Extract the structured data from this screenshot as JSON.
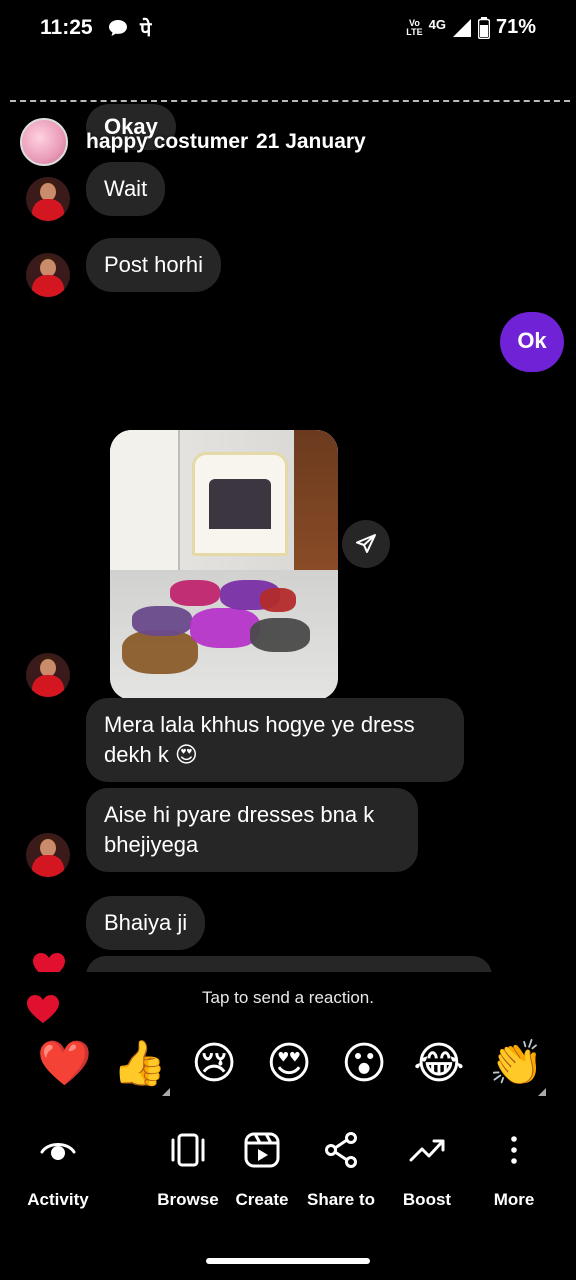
{
  "status_bar": {
    "time": "11:25",
    "hindi_char": "पे",
    "volte_top": "Vo",
    "volte_bottom": "LTE",
    "network": "4G",
    "battery": "71%"
  },
  "chat": {
    "header": {
      "partial_message": "Okay",
      "name": "happy costumer",
      "date": "21 January"
    },
    "messages": [
      {
        "text": "Wait",
        "sender": "other"
      },
      {
        "text": "Post horhi",
        "sender": "other"
      },
      {
        "text": "Ok",
        "sender": "me"
      },
      {
        "text": "Mera lala khhus hogye ye dress dekh k 😍",
        "sender": "other"
      },
      {
        "text": "Aise hi pyare dresses bna k bhejiyega",
        "sender": "other"
      },
      {
        "text": "Bhaiya ji",
        "sender": "other"
      }
    ],
    "icons": {
      "forward": "paper-plane-icon",
      "reaction_heart": "heart-icon"
    }
  },
  "reactions": {
    "hint": "Tap to send a reaction.",
    "emojis": [
      "❤️",
      "👍",
      "😢",
      "😍",
      "😮",
      "😂",
      "👏"
    ]
  },
  "toolbar": {
    "items": [
      {
        "label": "Activity",
        "icon": "eye-icon"
      },
      {
        "label": "Browse",
        "icon": "browse-icon"
      },
      {
        "label": "Create",
        "icon": "reels-icon"
      },
      {
        "label": "Share to",
        "icon": "share-icon"
      },
      {
        "label": "Boost",
        "icon": "trending-up-icon"
      },
      {
        "label": "More",
        "icon": "more-vertical-icon"
      }
    ]
  },
  "colors": {
    "background": "#000000",
    "received_bubble": "#262626",
    "sent_bubble": "#6f22d6",
    "heart": "#e0102e"
  }
}
